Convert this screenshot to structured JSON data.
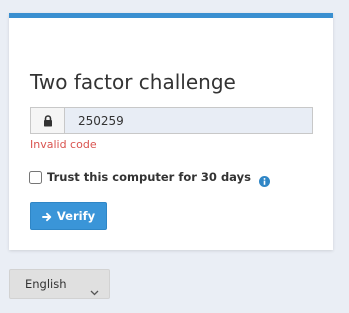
{
  "challenge": {
    "title": "Two factor challenge",
    "code_value": "250259",
    "error": "Invalid code",
    "trust_label": "Trust this computer for 30 days",
    "trust_checked": false,
    "verify_label": "Verify"
  },
  "language": {
    "selected": "English"
  },
  "icons": {
    "input_prefix": "lock-icon",
    "trust_info": "info-icon",
    "verify": "arrow-right-icon",
    "language": "chevron-down-icon"
  },
  "colors": {
    "accent": "#3a8fd0",
    "button": "#3a95d8",
    "error": "#d9534f",
    "info": "#2f86c6",
    "background": "#eaeef5"
  }
}
